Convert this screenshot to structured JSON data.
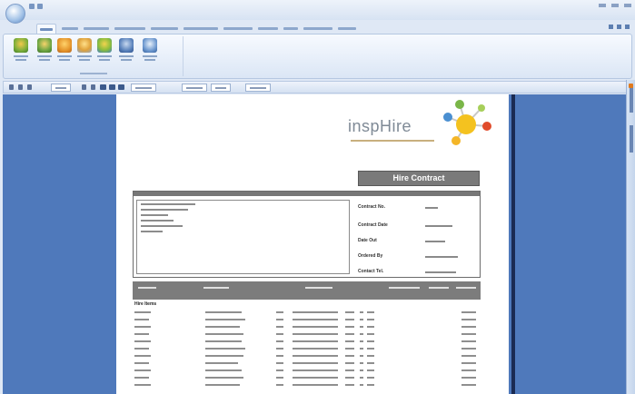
{
  "app": {
    "brand_name": "inspHire",
    "report_title": "Hire Contract"
  },
  "colors": {
    "ribbon_bg": "#dbe6f5",
    "report_bg": "#4f79bb",
    "paper_bg": "#ffffff",
    "header_grey": "#7a7a7a",
    "accent_orange": "#e07a1e"
  },
  "icons": {
    "app_orb": "application-orb-icon",
    "ribbon": [
      "new-contract-icon",
      "amend-contract-icon",
      "quick-hire-icon",
      "off-hire-icon",
      "exchange-icon",
      "transfer-icon",
      "create-new-sale-icon"
    ],
    "toolbar": [
      "first-page-icon",
      "prev-page-icon",
      "next-page-icon",
      "last-page-icon",
      "print-icon",
      "export-icon",
      "zoom-icon"
    ],
    "logo": "insphire-molecule-logo"
  },
  "report": {
    "field_labels": [
      "Contract No.",
      "Contract Date",
      "Date Out",
      "Ordered By",
      "Contact Tel."
    ],
    "section_label": "Hire Items"
  }
}
